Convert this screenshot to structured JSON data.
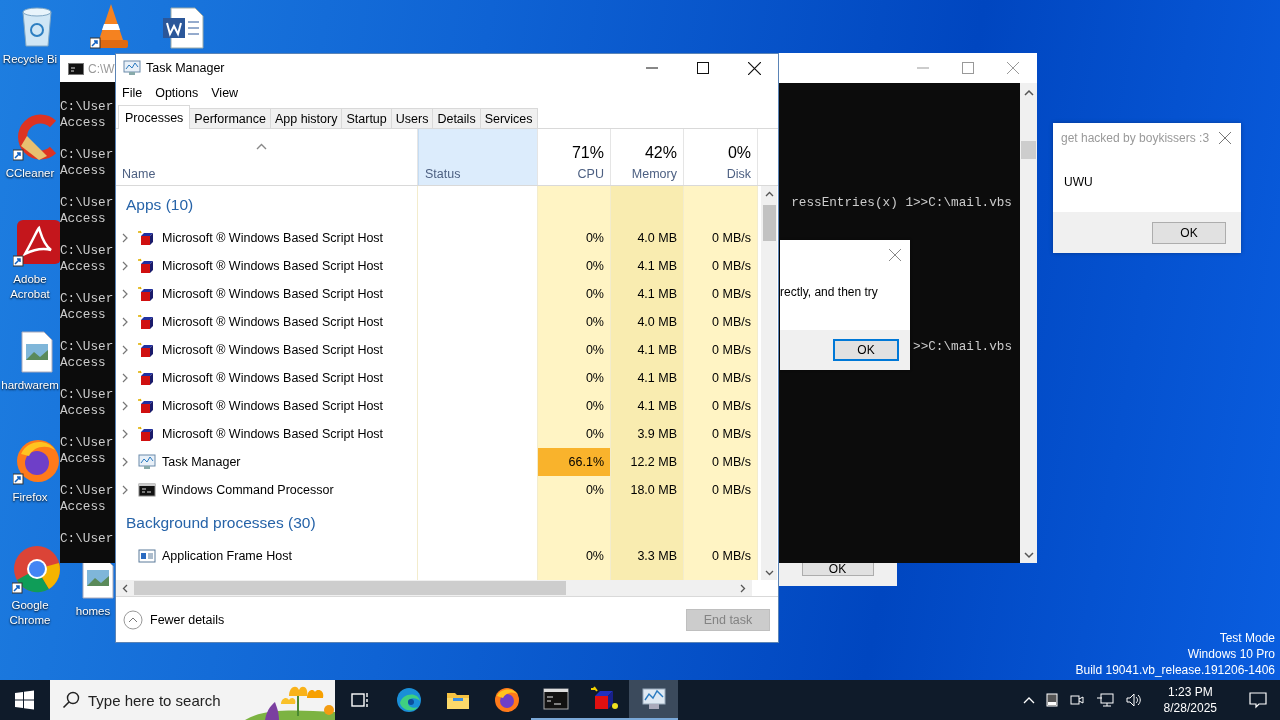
{
  "desktop": {
    "icons": [
      {
        "label": "Recycle Bi",
        "kind": "recycle"
      },
      {
        "kind": "vlc"
      },
      {
        "kind": "word"
      },
      {
        "label": "CCleaner",
        "kind": "ccleaner"
      },
      {
        "label": "Adobe Acrobat",
        "kind": "acrobat"
      },
      {
        "label": "hardwarem",
        "kind": "image-file"
      },
      {
        "label": "Firefox",
        "kind": "firefox"
      },
      {
        "label": "Google Chrome",
        "kind": "chrome"
      },
      {
        "label": "homes",
        "kind": "image-file"
      }
    ],
    "notice": [
      "Test Mode",
      "Windows 10 Pro",
      "Build 19041.vb_release.191206-1406"
    ]
  },
  "console_left": {
    "title": "C:\\W",
    "lines": [
      "C:\\User",
      "Access",
      "C:\\User",
      "Access",
      "C:\\User",
      "Access",
      "C:\\User",
      "Access",
      "C:\\User",
      "Access",
      "C:\\User",
      "Access",
      "C:\\User",
      "Access",
      "C:\\User",
      "Access",
      "C:\\User",
      "Access",
      "C:\\User"
    ]
  },
  "console_right": {
    "lines": [
      "ressEntries(x) 1>>C:\\mail.vbs",
      ">>C:\\mail.vbs"
    ]
  },
  "error_dialog": {
    "text": "rectly, and then try",
    "button": "OK",
    "button_focused": true
  },
  "hidden_dialog": {
    "button": "OK"
  },
  "message_box": {
    "title": "get hacked by boykissers :3",
    "text": "UWU",
    "button": "OK"
  },
  "task_manager": {
    "title": "Task Manager",
    "menu": [
      "File",
      "Options",
      "View"
    ],
    "tabs": [
      {
        "label": "Processes",
        "selected": true
      },
      {
        "label": "Performance",
        "selected": false
      },
      {
        "label": "App history",
        "selected": false
      },
      {
        "label": "Startup",
        "selected": false
      },
      {
        "label": "Users",
        "selected": false
      },
      {
        "label": "Details",
        "selected": false
      },
      {
        "label": "Services",
        "selected": false
      }
    ],
    "columns": [
      {
        "label": "Name",
        "sorted": true,
        "selected": false
      },
      {
        "label": "Status",
        "sorted": false,
        "selected": true
      },
      {
        "total": "71%",
        "label": "CPU",
        "sorted": false,
        "selected": false
      },
      {
        "total": "42%",
        "label": "Memory",
        "sorted": false,
        "selected": false
      },
      {
        "total": "0%",
        "label": "Disk",
        "sorted": false,
        "selected": false
      }
    ],
    "groups": [
      {
        "title": "Apps (10)",
        "rows": [
          {
            "name": "Microsoft ® Windows Based Script Host",
            "kind": "script",
            "expandable": true,
            "cpu": "0%",
            "cpu_high": false,
            "memory": "4.0 MB",
            "disk": "0 MB/s"
          },
          {
            "name": "Microsoft ® Windows Based Script Host",
            "kind": "script",
            "expandable": true,
            "cpu": "0%",
            "cpu_high": false,
            "memory": "4.1 MB",
            "disk": "0 MB/s"
          },
          {
            "name": "Microsoft ® Windows Based Script Host",
            "kind": "script",
            "expandable": true,
            "cpu": "0%",
            "cpu_high": false,
            "memory": "4.1 MB",
            "disk": "0 MB/s"
          },
          {
            "name": "Microsoft ® Windows Based Script Host",
            "kind": "script",
            "expandable": true,
            "cpu": "0%",
            "cpu_high": false,
            "memory": "4.0 MB",
            "disk": "0 MB/s"
          },
          {
            "name": "Microsoft ® Windows Based Script Host",
            "kind": "script",
            "expandable": true,
            "cpu": "0%",
            "cpu_high": false,
            "memory": "4.1 MB",
            "disk": "0 MB/s"
          },
          {
            "name": "Microsoft ® Windows Based Script Host",
            "kind": "script",
            "expandable": true,
            "cpu": "0%",
            "cpu_high": false,
            "memory": "4.1 MB",
            "disk": "0 MB/s"
          },
          {
            "name": "Microsoft ® Windows Based Script Host",
            "kind": "script",
            "expandable": true,
            "cpu": "0%",
            "cpu_high": false,
            "memory": "4.1 MB",
            "disk": "0 MB/s"
          },
          {
            "name": "Microsoft ® Windows Based Script Host",
            "kind": "script",
            "expandable": true,
            "cpu": "0%",
            "cpu_high": false,
            "memory": "3.9 MB",
            "disk": "0 MB/s"
          },
          {
            "name": "Task Manager",
            "kind": "taskmgr",
            "expandable": true,
            "cpu": "66.1%",
            "cpu_high": true,
            "memory": "12.2 MB",
            "disk": "0 MB/s"
          },
          {
            "name": "Windows Command Processor",
            "kind": "cmd",
            "expandable": true,
            "cpu": "0%",
            "cpu_high": false,
            "memory": "18.0 MB",
            "disk": "0 MB/s"
          }
        ]
      },
      {
        "title": "Background processes (30)",
        "rows": [
          {
            "name": "Application Frame Host",
            "kind": "frame",
            "expandable": false,
            "cpu": "0%",
            "cpu_high": false,
            "memory": "3.3 MB",
            "disk": "0 MB/s"
          }
        ]
      }
    ],
    "footer": {
      "toggle": "Fewer details",
      "button": "End task",
      "button_disabled": true
    }
  },
  "taskbar": {
    "search": {
      "placeholder": "Type here to search"
    },
    "apps": [
      {
        "kind": "task-view",
        "running": false,
        "active": false
      },
      {
        "kind": "edge",
        "running": false,
        "active": false
      },
      {
        "kind": "explorer",
        "running": false,
        "active": false
      },
      {
        "kind": "firefox",
        "running": false,
        "active": false
      },
      {
        "kind": "cmd",
        "running": true,
        "active": false
      },
      {
        "kind": "script",
        "running": true,
        "active": false
      },
      {
        "kind": "taskmgr",
        "running": true,
        "active": true
      }
    ],
    "time": "1:23 PM",
    "date": "8/28/2025"
  }
}
